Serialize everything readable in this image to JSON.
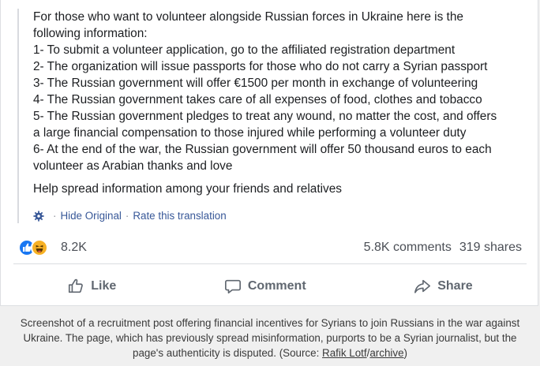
{
  "post": {
    "lines": [
      "For those who want to volunteer alongside Russian forces in Ukraine here is the",
      "following information:",
      "1- To submit a volunteer application, go to the affiliated registration department",
      "2- The organization will issue passports for those who do not carry a Syrian passport",
      "3- The Russian government will offer €1500 per month in exchange of volunteering",
      "4- The Russian government takes care of all expenses of food, clothes and tobacco",
      "5- The Russian government pledges to treat any wound, no matter the cost, and offers",
      "a large financial compensation to those injured while performing a volunteer duty",
      "6- At the end of the war, the Russian government will offer 50 thousand euros to each",
      "volunteer as Arabian thanks and love"
    ],
    "closing": "Help spread information among your friends and relatives"
  },
  "translation": {
    "hide_original": "Hide Original",
    "separator": "·",
    "rate": "Rate this translation"
  },
  "stats": {
    "reactions_count": "8.2K",
    "comments": "5.8K comments",
    "shares": "319 shares"
  },
  "actions": {
    "like": "Like",
    "comment": "Comment",
    "share": "Share"
  },
  "caption": {
    "text": "Screenshot of a recruitment post offering financial incentives for Syrians to join Russians in the war against Ukraine. The page, which has previously spread misinformation, purports to be a Syrian journalist, but the page's authenticity is disputed. (Source: ",
    "link1": "Rafik Lotf",
    "slash": "/",
    "link2": "archive",
    "end": ")"
  },
  "icons": {
    "gear": "gear-icon",
    "like_reaction": "like-reaction-icon",
    "haha_reaction": "haha-reaction-icon",
    "like": "thumbs-up-icon",
    "comment": "comment-bubble-icon",
    "share": "share-arrow-icon"
  },
  "colors": {
    "link": "#385898",
    "like_blue": "#1877f2",
    "haha_yellow": "#f7b125",
    "action_gray": "#606770"
  }
}
